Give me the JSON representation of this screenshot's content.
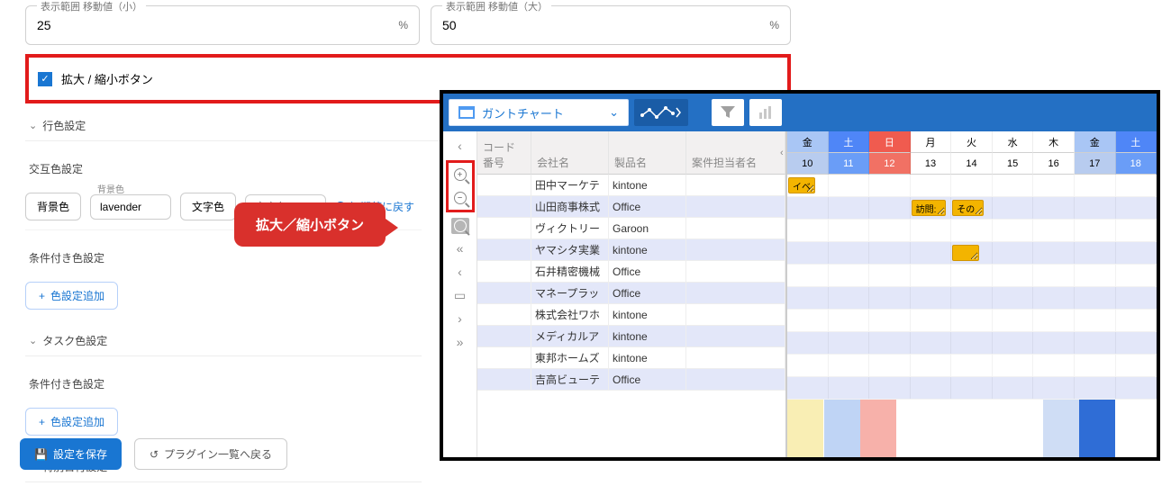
{
  "fields": {
    "small": {
      "label": "表示範囲 移動値（小）",
      "value": "25"
    },
    "large": {
      "label": "表示範囲 移動値（大）",
      "value": "50"
    },
    "percent": "%"
  },
  "zoom_toggle": "拡大 / 縮小ボタン",
  "callout": "拡大／縮小ボタン",
  "sections": {
    "row_color": "行色設定",
    "alt_color": "交互色設定",
    "cond_color": "条件付き色設定",
    "task_color": "タスク色設定",
    "special_date": "特別日付設定"
  },
  "alt": {
    "bg_label": "背景色",
    "bg_value": "lavender",
    "fg_label": "文字色",
    "fg_placeholder": "文字色",
    "tiny_label": "背景色"
  },
  "reset": "初期値に戻す",
  "add_color": "色設定追加",
  "buttons": {
    "save": "設定を保存",
    "back": "プラグイン一覧へ戻る"
  },
  "gantt": {
    "chart_label": "ガントチャート",
    "columns": {
      "idx": "コード番号",
      "co": "会社名",
      "prod": "製品名",
      "pic": "案件担当者名"
    },
    "rows": [
      {
        "co": "田中マーケテ",
        "prod": "kintone"
      },
      {
        "co": "山田商事株式",
        "prod": "Office"
      },
      {
        "co": "ヴィクトリー",
        "prod": "Garoon"
      },
      {
        "co": "ヤマシタ実業",
        "prod": "kintone"
      },
      {
        "co": "石井精密機械",
        "prod": "Office"
      },
      {
        "co": "マネープラッ",
        "prod": "Office"
      },
      {
        "co": "株式会社ワホ",
        "prod": "kintone"
      },
      {
        "co": "メディカルア",
        "prod": "kintone"
      },
      {
        "co": "東邦ホームズ",
        "prod": "kintone"
      },
      {
        "co": "吉高ビューテ",
        "prod": "Office"
      }
    ],
    "days_name": [
      "金",
      "土",
      "日",
      "月",
      "火",
      "水",
      "木",
      "金",
      "土"
    ],
    "days_num": [
      "10",
      "11",
      "12",
      "13",
      "14",
      "15",
      "16",
      "17",
      "18"
    ],
    "tasks": {
      "event": "イベ",
      "visit": "訪問:",
      "other": "その"
    }
  }
}
